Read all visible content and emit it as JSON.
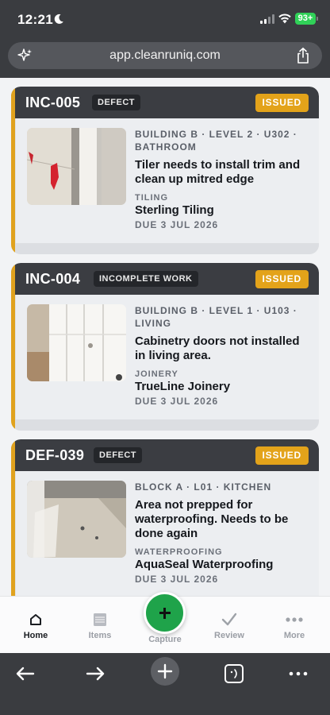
{
  "status_bar": {
    "time": "12:21",
    "battery": "93+"
  },
  "browser": {
    "url": "app.cleanruniq.com"
  },
  "cards": [
    {
      "code": "INC-005",
      "type": "DEFECT",
      "status": "ISSUED",
      "location": "BUILDING B · LEVEL 2 · U302 · BATHROOM",
      "title": "Tiler needs to install trim and clean up mitred edge",
      "trade": "TILING",
      "company": "Sterling Tiling",
      "due": "DUE 3 JUL 2026"
    },
    {
      "code": "INC-004",
      "type": "INCOMPLETE WORK",
      "status": "ISSUED",
      "location": "BUILDING B · LEVEL 1 · U103 · LIVING",
      "title": "Cabinetry doors not installed in living area.",
      "trade": "JOINERY",
      "company": "TrueLine Joinery",
      "due": "DUE 3 JUL 2026"
    },
    {
      "code": "DEF-039",
      "type": "DEFECT",
      "status": "ISSUED",
      "location": "BLOCK A · L01 · KITCHEN",
      "title": "Area not prepped for waterproofing. Needs to be done again",
      "trade": "WATERPROOFING",
      "company": "AquaSeal Waterproofing",
      "due": "DUE 3 JUL 2026"
    }
  ],
  "tabbar": {
    "home": "Home",
    "items": "Items",
    "capture": "Capture",
    "review": "Review",
    "more": "More"
  },
  "colors": {
    "accent": "#e0a21e",
    "status_badge": "#e3a31a",
    "capture": "#1fa34a",
    "header": "#3b3d42"
  }
}
